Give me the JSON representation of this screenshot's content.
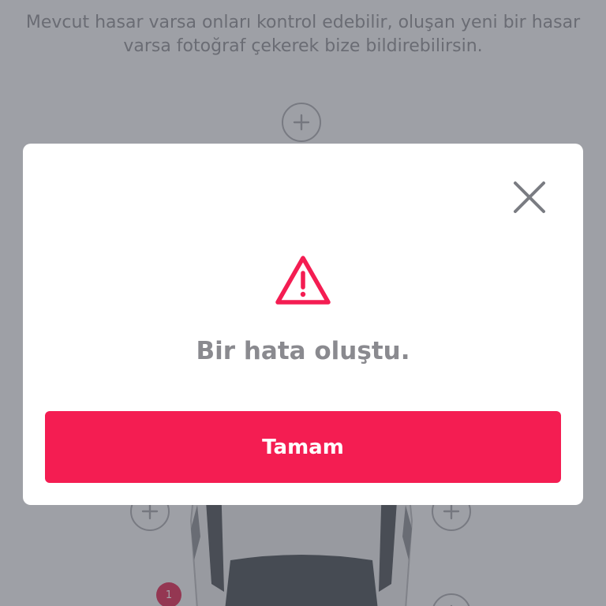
{
  "background": {
    "info_text": "Mevcut hasar varsa onları kontrol edebilir, oluşan yeni bir hasar varsa fotoğraf çekerek bize bildirebilirsin.",
    "damage_count": "1"
  },
  "dialog": {
    "message": "Bir hata oluştu.",
    "confirm_label": "Tamam",
    "icons": {
      "close": "close-icon",
      "warning": "warning-icon"
    }
  },
  "colors": {
    "accent": "#f41d52",
    "warning": "#f41d52",
    "overlay": "rgba(72,75,86,0.5)"
  }
}
